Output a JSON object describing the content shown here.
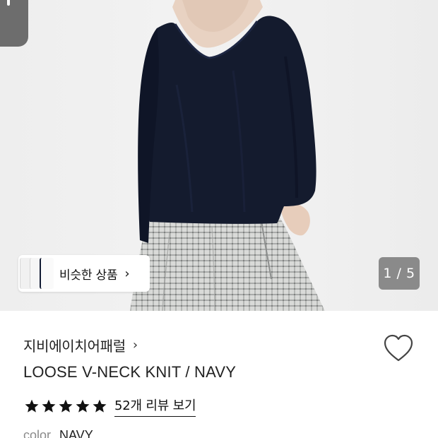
{
  "gallery": {
    "similar_label": "비슷한 상품",
    "similar_chevron": "›",
    "page_counter": "1 / 5",
    "current_index": 1,
    "total": 5
  },
  "product": {
    "brand": "지비에이치어패럴",
    "brand_chevron": "›",
    "title": "LOOSE V-NECK KNIT / NAVY",
    "rating_stars": 5,
    "review_link": "52개 리뷰 보기",
    "option_label": "color",
    "option_value": "NAVY",
    "wishlisted": false
  },
  "icons": {
    "wishlist": "heart-outline-icon",
    "star": "star-icon",
    "chevron": "chevron-right-icon"
  },
  "colors": {
    "knit": "#141b2e",
    "star": "#111111",
    "counter_bg": "#6e6e6e"
  }
}
